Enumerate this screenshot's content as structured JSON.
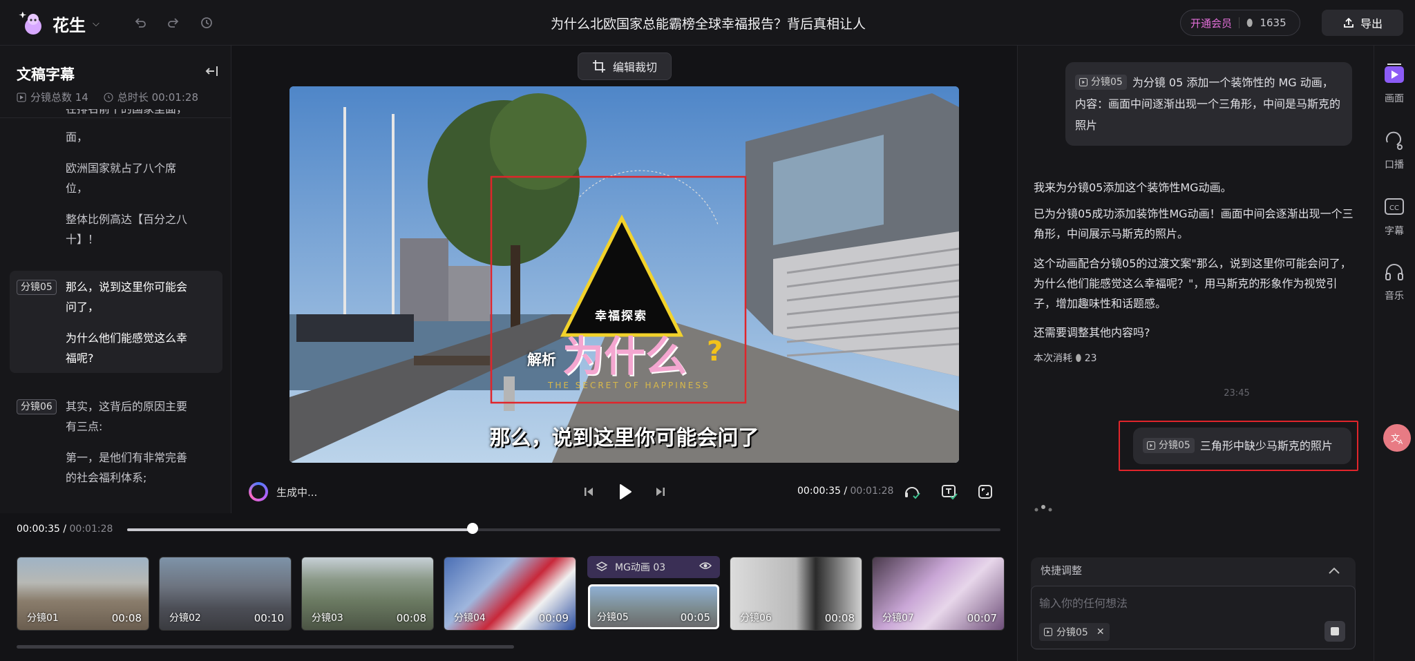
{
  "app": {
    "brand": "花生"
  },
  "header": {
    "title": "为什么北欧国家总能霸榜全球幸福报告？背后真相让人",
    "vip_label": "开通会员",
    "credits": "1635",
    "export_label": "导出"
  },
  "left_panel": {
    "title": "文稿字幕",
    "segment_count": "分镜总数 14",
    "total_duration": "总时长 00:01:28",
    "items": [
      {
        "tag": "",
        "text": "在排名前十的国家里面，"
      },
      {
        "tag": "",
        "text": "欧洲国家就占了八个席位，"
      },
      {
        "tag": "",
        "text": "整体比例高达【百分之八十】！"
      },
      {
        "tag": "分镜05",
        "text": "那么，说到这里你可能会问了，"
      },
      {
        "tag": "",
        "text": "为什么他们能感觉这么幸福呢?"
      },
      {
        "tag": "分镜06",
        "text": "其实，这背后的原因主要有三点:"
      },
      {
        "tag": "",
        "text": "第一，是他们有非常完善的社会福利体系;"
      }
    ]
  },
  "editor": {
    "crop_label": "编辑裁切",
    "overlay": {
      "badge": "幸福探索",
      "prefix": "解析",
      "headline": "为什么",
      "qmark": "?",
      "tagline": "THE SECRET OF HAPPINESS"
    },
    "subtitle": "那么，说到这里你可能会问了",
    "generating": "生成中...",
    "time_current": "00:00:35",
    "time_total": "00:01:28",
    "progress_fraction": 0.4
  },
  "timeline": {
    "time_current": "00:00:35",
    "time_total": "00:01:28",
    "mg_label": "MG动画 03",
    "thumbs": [
      {
        "label": "分镜01",
        "duration": "00:08"
      },
      {
        "label": "分镜02",
        "duration": "00:10"
      },
      {
        "label": "分镜03",
        "duration": "00:08"
      },
      {
        "label": "分镜04",
        "duration": "00:09"
      },
      {
        "label": "分镜05",
        "duration": "00:05"
      },
      {
        "label": "分镜06",
        "duration": "00:08"
      },
      {
        "label": "分镜07",
        "duration": "00:07"
      }
    ]
  },
  "chat": {
    "msg1_tag": "分镜05",
    "msg1_text": "为分镜 05 添加一个装饰性的 MG 动画，内容：画面中间逐渐出现一个三角形，中间是马斯克的照片",
    "ai_1": "我来为分镜05添加这个装饰性MG动画。",
    "ai_2": "已为分镜05成功添加装饰性MG动画！画面中间会逐渐出现一个三角形，中间展示马斯克的照片。",
    "ai_3": "这个动画配合分镜05的过渡文案\"那么，说到这里你可能会问了，为什么他们能感觉这么幸福呢？\"，用马斯克的形象作为视觉引子，增加趣味性和话题感。",
    "ai_4": "还需要调整其他内容吗?",
    "cost_label": "本次消耗",
    "cost_value": "23",
    "timestamp": "23:45",
    "msg2_tag": "分镜05",
    "msg2_text": "三角形中缺少马斯克的照片",
    "quick_title": "快捷调整",
    "input_placeholder": "输入你的任何想法",
    "chip": "分镜05"
  },
  "rail": {
    "items": [
      {
        "label": "画面",
        "icon": "screen-icon"
      },
      {
        "label": "口播",
        "icon": "voice-icon"
      },
      {
        "label": "字幕",
        "icon": "cc-icon"
      },
      {
        "label": "音乐",
        "icon": "headphones-icon"
      }
    ]
  },
  "colors": {
    "accent_pink": "#e36fd9",
    "highlight_red": "#e0252b",
    "triangle_yellow": "#f2d22b"
  }
}
